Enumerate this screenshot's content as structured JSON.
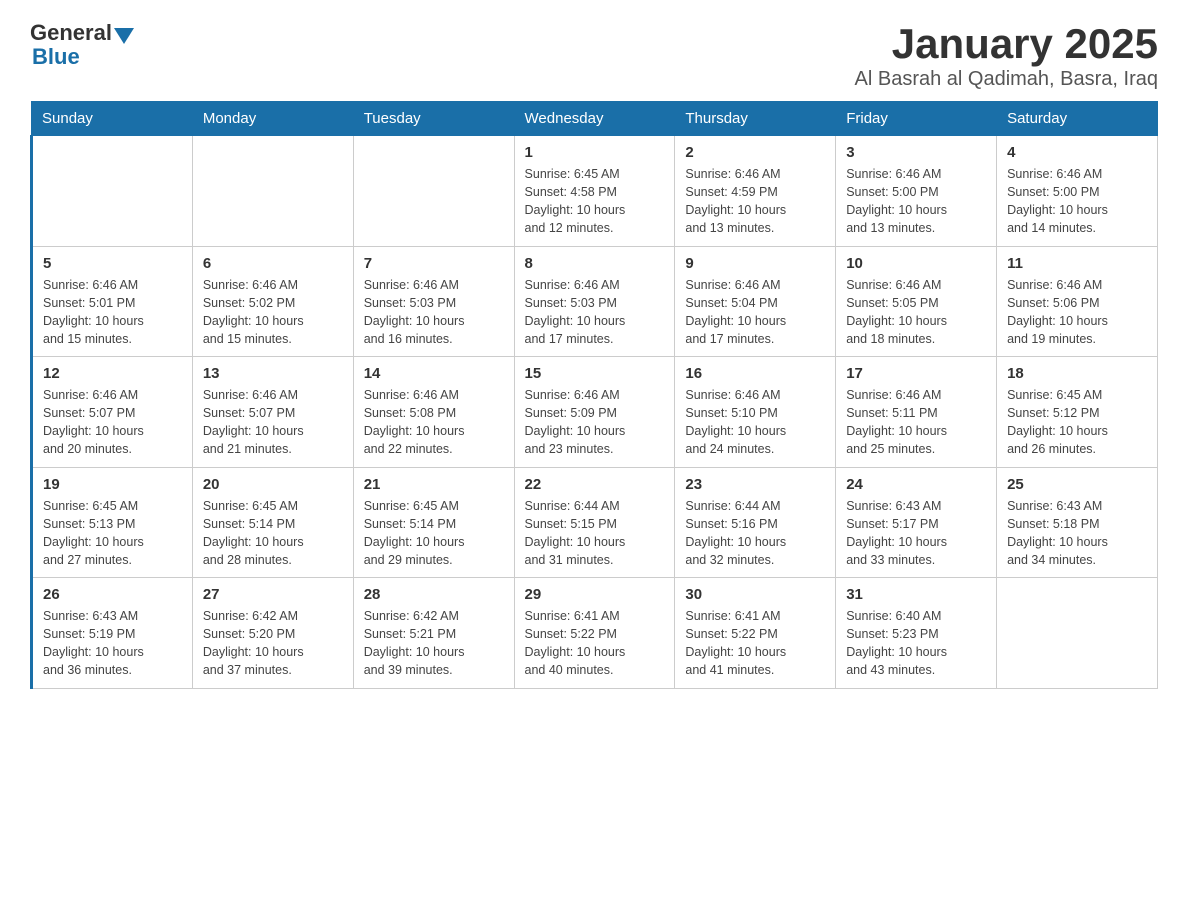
{
  "header": {
    "logo_general": "General",
    "logo_blue": "Blue",
    "title": "January 2025",
    "subtitle": "Al Basrah al Qadimah, Basra, Iraq"
  },
  "weekdays": [
    "Sunday",
    "Monday",
    "Tuesday",
    "Wednesday",
    "Thursday",
    "Friday",
    "Saturday"
  ],
  "weeks": [
    [
      {
        "day": "",
        "info": ""
      },
      {
        "day": "",
        "info": ""
      },
      {
        "day": "",
        "info": ""
      },
      {
        "day": "1",
        "info": "Sunrise: 6:45 AM\nSunset: 4:58 PM\nDaylight: 10 hours\nand 12 minutes."
      },
      {
        "day": "2",
        "info": "Sunrise: 6:46 AM\nSunset: 4:59 PM\nDaylight: 10 hours\nand 13 minutes."
      },
      {
        "day": "3",
        "info": "Sunrise: 6:46 AM\nSunset: 5:00 PM\nDaylight: 10 hours\nand 13 minutes."
      },
      {
        "day": "4",
        "info": "Sunrise: 6:46 AM\nSunset: 5:00 PM\nDaylight: 10 hours\nand 14 minutes."
      }
    ],
    [
      {
        "day": "5",
        "info": "Sunrise: 6:46 AM\nSunset: 5:01 PM\nDaylight: 10 hours\nand 15 minutes."
      },
      {
        "day": "6",
        "info": "Sunrise: 6:46 AM\nSunset: 5:02 PM\nDaylight: 10 hours\nand 15 minutes."
      },
      {
        "day": "7",
        "info": "Sunrise: 6:46 AM\nSunset: 5:03 PM\nDaylight: 10 hours\nand 16 minutes."
      },
      {
        "day": "8",
        "info": "Sunrise: 6:46 AM\nSunset: 5:03 PM\nDaylight: 10 hours\nand 17 minutes."
      },
      {
        "day": "9",
        "info": "Sunrise: 6:46 AM\nSunset: 5:04 PM\nDaylight: 10 hours\nand 17 minutes."
      },
      {
        "day": "10",
        "info": "Sunrise: 6:46 AM\nSunset: 5:05 PM\nDaylight: 10 hours\nand 18 minutes."
      },
      {
        "day": "11",
        "info": "Sunrise: 6:46 AM\nSunset: 5:06 PM\nDaylight: 10 hours\nand 19 minutes."
      }
    ],
    [
      {
        "day": "12",
        "info": "Sunrise: 6:46 AM\nSunset: 5:07 PM\nDaylight: 10 hours\nand 20 minutes."
      },
      {
        "day": "13",
        "info": "Sunrise: 6:46 AM\nSunset: 5:07 PM\nDaylight: 10 hours\nand 21 minutes."
      },
      {
        "day": "14",
        "info": "Sunrise: 6:46 AM\nSunset: 5:08 PM\nDaylight: 10 hours\nand 22 minutes."
      },
      {
        "day": "15",
        "info": "Sunrise: 6:46 AM\nSunset: 5:09 PM\nDaylight: 10 hours\nand 23 minutes."
      },
      {
        "day": "16",
        "info": "Sunrise: 6:46 AM\nSunset: 5:10 PM\nDaylight: 10 hours\nand 24 minutes."
      },
      {
        "day": "17",
        "info": "Sunrise: 6:46 AM\nSunset: 5:11 PM\nDaylight: 10 hours\nand 25 minutes."
      },
      {
        "day": "18",
        "info": "Sunrise: 6:45 AM\nSunset: 5:12 PM\nDaylight: 10 hours\nand 26 minutes."
      }
    ],
    [
      {
        "day": "19",
        "info": "Sunrise: 6:45 AM\nSunset: 5:13 PM\nDaylight: 10 hours\nand 27 minutes."
      },
      {
        "day": "20",
        "info": "Sunrise: 6:45 AM\nSunset: 5:14 PM\nDaylight: 10 hours\nand 28 minutes."
      },
      {
        "day": "21",
        "info": "Sunrise: 6:45 AM\nSunset: 5:14 PM\nDaylight: 10 hours\nand 29 minutes."
      },
      {
        "day": "22",
        "info": "Sunrise: 6:44 AM\nSunset: 5:15 PM\nDaylight: 10 hours\nand 31 minutes."
      },
      {
        "day": "23",
        "info": "Sunrise: 6:44 AM\nSunset: 5:16 PM\nDaylight: 10 hours\nand 32 minutes."
      },
      {
        "day": "24",
        "info": "Sunrise: 6:43 AM\nSunset: 5:17 PM\nDaylight: 10 hours\nand 33 minutes."
      },
      {
        "day": "25",
        "info": "Sunrise: 6:43 AM\nSunset: 5:18 PM\nDaylight: 10 hours\nand 34 minutes."
      }
    ],
    [
      {
        "day": "26",
        "info": "Sunrise: 6:43 AM\nSunset: 5:19 PM\nDaylight: 10 hours\nand 36 minutes."
      },
      {
        "day": "27",
        "info": "Sunrise: 6:42 AM\nSunset: 5:20 PM\nDaylight: 10 hours\nand 37 minutes."
      },
      {
        "day": "28",
        "info": "Sunrise: 6:42 AM\nSunset: 5:21 PM\nDaylight: 10 hours\nand 39 minutes."
      },
      {
        "day": "29",
        "info": "Sunrise: 6:41 AM\nSunset: 5:22 PM\nDaylight: 10 hours\nand 40 minutes."
      },
      {
        "day": "30",
        "info": "Sunrise: 6:41 AM\nSunset: 5:22 PM\nDaylight: 10 hours\nand 41 minutes."
      },
      {
        "day": "31",
        "info": "Sunrise: 6:40 AM\nSunset: 5:23 PM\nDaylight: 10 hours\nand 43 minutes."
      },
      {
        "day": "",
        "info": ""
      }
    ]
  ]
}
